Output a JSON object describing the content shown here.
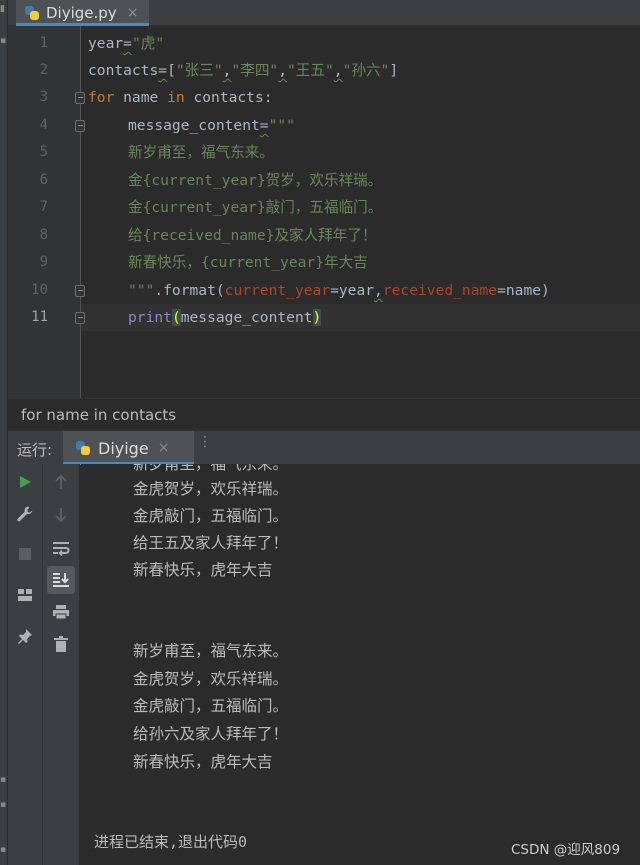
{
  "tab": {
    "filename": "Diyige.py",
    "close": "×"
  },
  "editor": {
    "line_numbers": [
      "1",
      "2",
      "3",
      "4",
      "5",
      "6",
      "7",
      "8",
      "9",
      "10",
      "11"
    ],
    "lines": {
      "l1": {
        "var": "year",
        "eq": "=",
        "val": "\"虎\""
      },
      "l2": {
        "var": "contacts",
        "eq": "=",
        "open": "[",
        "s1": "\"张三\"",
        "s2": "\"李四\"",
        "s3": "\"王五\"",
        "s4": "\"孙六\"",
        "comma": ",",
        "close": "]"
      },
      "l3": {
        "kw_for": "for",
        "var": " name ",
        "kw_in": "in",
        "rest": " contacts:"
      },
      "l4": {
        "var": "message_content",
        "eq": "=",
        "val": "\"\"\""
      },
      "l5": "新岁甫至，福气东来。",
      "l6": "金{current_year}贺岁，欢乐祥瑞。",
      "l7": "金{current_year}敲门，五福临门。",
      "l8": "给{received_name}及家人拜年了！",
      "l9": "新春快乐，{current_year}年大吉",
      "l10": {
        "str": "\"\"\"",
        "method": ".format(",
        "p1": "current_year",
        "eq1": "=",
        "v1": "year",
        "comma": ",",
        "p2": "received_name",
        "eq2": "=",
        "v2": "name",
        "close": ")"
      },
      "l11": {
        "fn": "print",
        "open": "(",
        "arg": "message_content",
        "close": ")"
      }
    }
  },
  "breadcrumb": "for name in contacts",
  "run": {
    "label": "运行:",
    "tab_name": "Diyige",
    "close": "×",
    "more": "⋮"
  },
  "console": {
    "lines": [
      "新岁甫至，福气东来。",
      "金虎贺岁，欢乐祥瑞。",
      "金虎敲门，五福临门。",
      "给王五及家人拜年了！",
      "新春快乐，虎年大吉",
      "新岁甫至，福气东来。",
      "金虎贺岁，欢乐祥瑞。",
      "金虎敲门，五福临门。",
      "给孙六及家人拜年了！",
      "新春快乐，虎年大吉"
    ],
    "exit": "进程已结束,退出代码0"
  },
  "watermark": "CSDN @迎风809",
  "colors": {
    "keyword": "#cc7832",
    "string": "#6a8759",
    "builtin": "#8888c6",
    "param": "#aa4926",
    "run_green": "#499c54",
    "accent": "#4a88c7"
  },
  "icons": [
    "python-file-icon",
    "rerun-icon",
    "settings-wrench-icon",
    "stop-icon",
    "layout-icon",
    "pin-icon",
    "up-arrow-icon",
    "down-arrow-icon",
    "soft-wrap-icon",
    "scroll-to-end-icon",
    "print-icon",
    "trash-icon"
  ]
}
